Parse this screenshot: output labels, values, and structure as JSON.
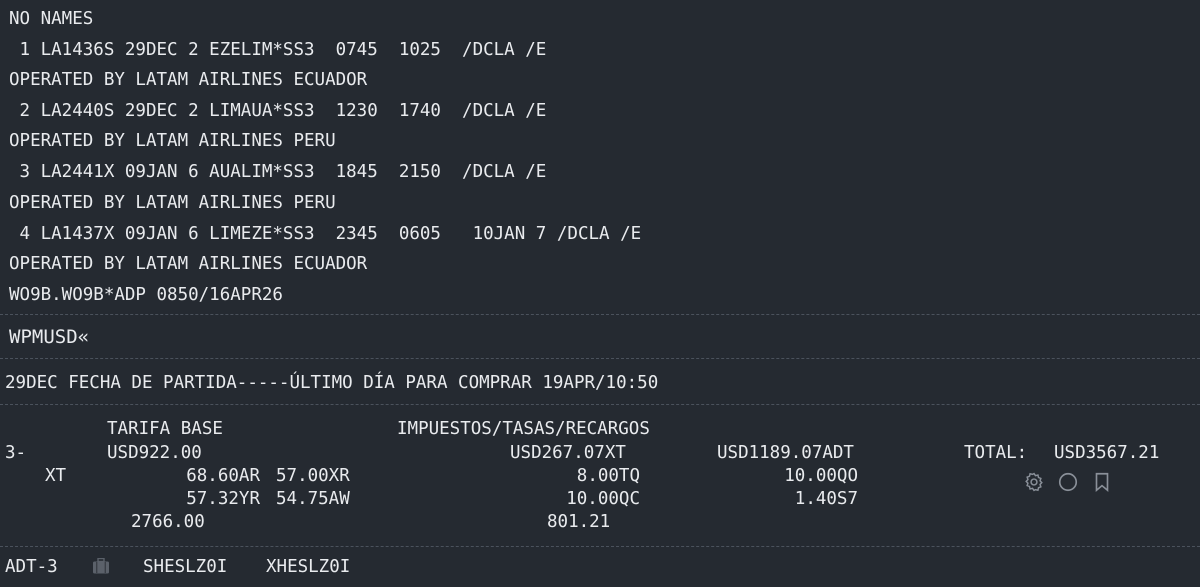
{
  "pnr": {
    "header": "NO NAMES",
    "segments": [
      {
        "line": " 1 LA1436S 29DEC 2 EZELIM*SS3  0745  1025  /DCLA /E",
        "operated_by": "OPERATED BY LATAM AIRLINES ECUADOR"
      },
      {
        "line": " 2 LA2440S 29DEC 2 LIMAUA*SS3  1230  1740  /DCLA /E",
        "operated_by": "OPERATED BY LATAM AIRLINES PERU"
      },
      {
        "line": " 3 LA2441X 09JAN 6 AUALIM*SS3  1845  2150  /DCLA /E",
        "operated_by": "OPERATED BY LATAM AIRLINES PERU"
      },
      {
        "line": " 4 LA1437X 09JAN 6 LIMEZE*SS3  2345  0605   10JAN 7 /DCLA /E",
        "operated_by": "OPERATED BY LATAM AIRLINES ECUADOR"
      }
    ],
    "agent_line": "WO9B.WO9B*ADP 0850/16APR26"
  },
  "command": "WPMUSD«",
  "ticketing_notice": "29DEC FECHA DE PARTIDA-----ÚLTIMO DÍA PARA COMPRAR 19APR/10:50",
  "fare": {
    "header_base": "TARIFA BASE",
    "header_taxes": "IMPUESTOS/TASAS/RECARGOS",
    "pax_count": "3-",
    "base": "USD922.00",
    "taxes": "USD267.07XT",
    "per_pax": "USD1189.07ADT",
    "total_label": "TOTAL:",
    "total": "USD3567.21",
    "xt_label": "XT",
    "xt_row1": [
      "68.60AR",
      "57.00XR",
      "8.00TQ",
      "10.00QO"
    ],
    "xt_row2": [
      "57.32YR",
      "54.75AW",
      "10.00QC",
      "1.40S7"
    ],
    "sum_base": "2766.00",
    "sum_taxes": "801.21"
  },
  "footer": {
    "pax_type": "ADT-3",
    "fare_basis": [
      "SHESLZ0I",
      "XHESLZ0I"
    ]
  },
  "icons": [
    "gear-icon",
    "circle-icon",
    "bookmark-icon",
    "baggage-icon"
  ],
  "colors": {
    "background": "#252a31",
    "text": "#e9ebee",
    "icon": "#8a9099"
  }
}
